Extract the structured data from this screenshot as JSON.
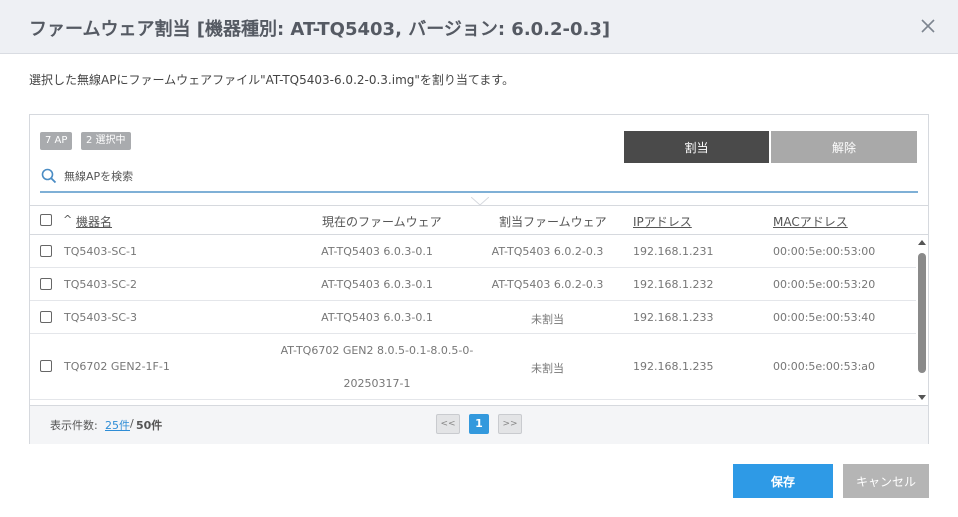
{
  "dialog": {
    "title": "ファームウェア割当 [機器種別: AT-TQ5403, バージョン: 6.0.2-0.3]",
    "description": "選択した無線APにファームウェアファイル\"AT-TQ5403-6.0.2-0.3.img\"を割り当てます。",
    "close_icon": "close-icon"
  },
  "panel": {
    "badges": {
      "ap_count": "7 AP",
      "selected_count": "2 選択中"
    },
    "assign_label": "割当",
    "release_label": "解除",
    "search": {
      "placeholder": "無線APを検索",
      "value": "",
      "icon": "search-icon"
    }
  },
  "table": {
    "sort_indicator": "^",
    "headers": {
      "name": "機器名",
      "current_fw": "現在のファームウェア",
      "assigned_fw": "割当ファームウェア",
      "ip": "IPアドレス",
      "mac": "MACアドレス"
    },
    "rows": [
      {
        "name": "TQ5403-SC-1",
        "current_fw": "AT-TQ5403 6.0.3-0.1",
        "assigned_fw": "AT-TQ5403 6.0.2-0.3",
        "ip": "192.168.1.231",
        "mac": "00:00:5e:00:53:00"
      },
      {
        "name": "TQ5403-SC-2",
        "current_fw": "AT-TQ5403 6.0.3-0.1",
        "assigned_fw": "AT-TQ5403 6.0.2-0.3",
        "ip": "192.168.1.232",
        "mac": "00:00:5e:00:53:20"
      },
      {
        "name": "TQ5403-SC-3",
        "current_fw": "AT-TQ5403 6.0.3-0.1",
        "assigned_fw": "未割当",
        "ip": "192.168.1.233",
        "mac": "00:00:5e:00:53:40"
      },
      {
        "name": "TQ6702 GEN2-1F-1",
        "current_fw_line1": "AT-TQ6702 GEN2 8.0.5-0.1-8.0.5-0-",
        "current_fw_line2": "20250317-1",
        "assigned_fw": "未割当",
        "ip": "192.168.1.235",
        "mac": "00:00:5e:00:53:a0"
      }
    ]
  },
  "pagination": {
    "per_page_label": "表示件数:",
    "per_page_value": "25件",
    "separator": "/",
    "total": "50件",
    "prev_label": "<<",
    "current_page": "1",
    "next_label": ">>"
  },
  "actions": {
    "save_label": "保存",
    "cancel_label": "キャンセル"
  },
  "colors": {
    "accent": "#2e9ae6",
    "assign_button": "#4a4a4a",
    "disabled_button": "#a9a9a9"
  }
}
